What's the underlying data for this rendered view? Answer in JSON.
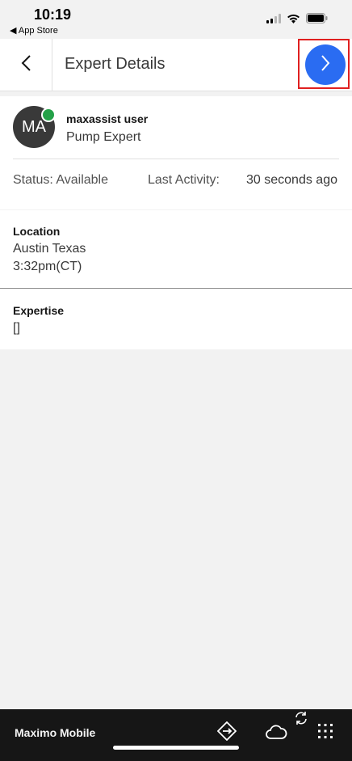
{
  "status_bar": {
    "time": "10:19",
    "back_app": "◀ App Store"
  },
  "header": {
    "title": "Expert Details"
  },
  "person": {
    "initials": "MA",
    "name": "maxassist user",
    "role": "Pump Expert",
    "status": "Status: Available",
    "last_activity_label": "Last Activity:",
    "last_activity_value": "30 seconds ago"
  },
  "details": {
    "location_label": "Location",
    "location_value": "Austin Texas",
    "location_time": "3:32pm(CT)",
    "expertise_label": "Expertise",
    "expertise_value": "[]"
  },
  "bottom_bar": {
    "app_name": "Maximo Mobile"
  },
  "colors": {
    "accent": "#2a6cf2",
    "online": "#24a148",
    "highlight": "#e02020"
  },
  "icons": [
    "chevron-left-icon",
    "chevron-right-icon",
    "cellular-icon",
    "wifi-icon",
    "battery-icon",
    "navigation-icon",
    "cloud-icon",
    "sync-icon",
    "app-grid-icon"
  ]
}
